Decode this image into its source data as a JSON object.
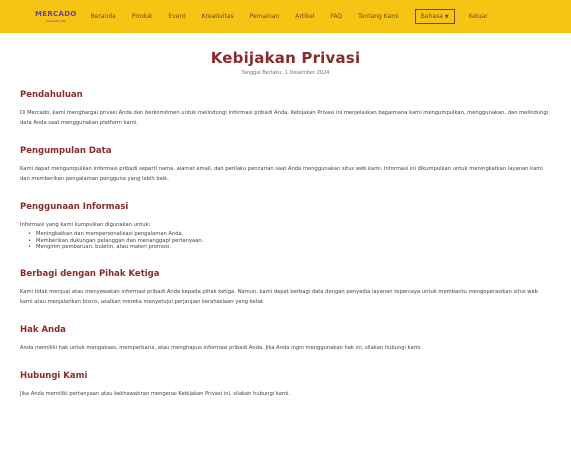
{
  "nav": {
    "logo": "MERCADO",
    "logo_sub": "mercado kita",
    "items": [
      "Beranda",
      "Produk",
      "Event",
      "Kreativitas",
      "Pemainan",
      "Artikel",
      "FAQ",
      "Tentang Kami"
    ],
    "language": "Bahasa",
    "logout": "Keluar"
  },
  "page": {
    "title": "Kebijakan Privasi",
    "updated": "Tanggal Berlaku: 1 Desember 2024"
  },
  "sections": [
    {
      "heading": "Pendahuluan",
      "text": "Di Mercado, kami menghargai privasi Anda dan berkomitmen untuk melindungi informasi pribadi Anda. Kebijakan Privasi ini menjelaskan bagaimana kami mengumpulkan, menggunakan, dan melindungi data Anda saat menggunakan platform kami."
    },
    {
      "heading": "Pengumpulan Data",
      "text": "Kami dapat mengumpulkan informasi pribadi seperti nama, alamat email, dan perilaku pencarian saat Anda menggunakan situs web kami. Informasi ini dikumpulkan untuk meningkatkan layanan kami dan memberikan pengalaman pengguna yang lebih baik."
    },
    {
      "heading": "Penggunaan Informasi",
      "text": "Informasi yang kami kumpulkan digunakan untuk:",
      "list": [
        "Meningkatkan dan mempersonalisasi pengalaman Anda.",
        "Memberikan dukungan pelanggan dan menanggapi pertanyaan.",
        "Mengirim pembaruan, buletin, atau materi promosi."
      ]
    },
    {
      "heading": "Berbagi dengan Pihak Ketiga",
      "text": "Kami tidak menjual atau menyewakan informasi pribadi Anda kepada pihak ketiga. Namun, kami dapat berbagi data dengan penyedia layanan tepercaya untuk membantu mengoperasikan situs web kami atau menjalankan bisnis, asalkan mereka menyetujui perjanjian kerahasiaan yang ketat."
    },
    {
      "heading": "Hak Anda",
      "text": "Anda memiliki hak untuk mengakses, memperbarui, atau menghapus informasi pribadi Anda. Jika Anda ingin menggunakan hak ini, silakan hubungi kami."
    },
    {
      "heading": "Hubungi Kami",
      "text": "Jika Anda memiliki pertanyaan atau kekhawatiran mengenai Kebijakan Privasi ini, silakan hubungi kami."
    }
  ],
  "colors": {
    "navbar": "#f6c514",
    "heading": "#8a2b2b"
  }
}
